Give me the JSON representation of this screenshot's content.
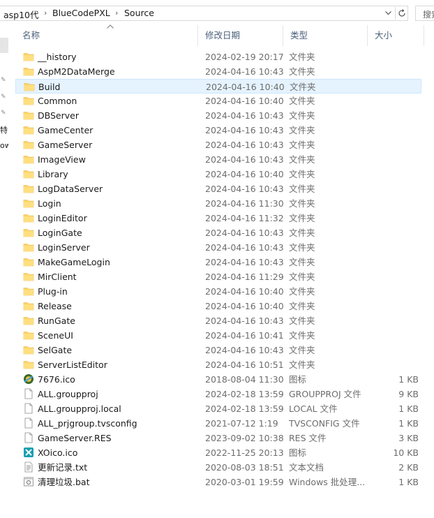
{
  "address": {
    "crumbs": [
      "asp10代",
      "BlueCodePXL",
      "Source"
    ],
    "search_placeholder": "搜索"
  },
  "nav": {
    "partial_labels": [
      "特",
      "ow"
    ]
  },
  "columns": {
    "name": "名称",
    "date": "修改日期",
    "type": "类型",
    "size": "大小"
  },
  "files": [
    {
      "name": "__history",
      "date": "2024-02-19 20:17",
      "type": "文件夹",
      "size": "",
      "icon": "folder-icon"
    },
    {
      "name": "AspM2DataMerge",
      "date": "2024-04-16 10:43",
      "type": "文件夹",
      "size": "",
      "icon": "folder-icon"
    },
    {
      "name": "Build",
      "date": "2024-04-16 10:40",
      "type": "文件夹",
      "size": "",
      "icon": "folder-icon",
      "selected": true
    },
    {
      "name": "Common",
      "date": "2024-04-16 10:40",
      "type": "文件夹",
      "size": "",
      "icon": "folder-icon"
    },
    {
      "name": "DBServer",
      "date": "2024-04-16 10:43",
      "type": "文件夹",
      "size": "",
      "icon": "folder-icon"
    },
    {
      "name": "GameCenter",
      "date": "2024-04-16 10:43",
      "type": "文件夹",
      "size": "",
      "icon": "folder-icon"
    },
    {
      "name": "GameServer",
      "date": "2024-04-16 10:43",
      "type": "文件夹",
      "size": "",
      "icon": "folder-icon"
    },
    {
      "name": "ImageView",
      "date": "2024-04-16 10:43",
      "type": "文件夹",
      "size": "",
      "icon": "folder-icon"
    },
    {
      "name": "Library",
      "date": "2024-04-16 10:40",
      "type": "文件夹",
      "size": "",
      "icon": "folder-icon"
    },
    {
      "name": "LogDataServer",
      "date": "2024-04-16 10:43",
      "type": "文件夹",
      "size": "",
      "icon": "folder-icon"
    },
    {
      "name": "Login",
      "date": "2024-04-16 11:30",
      "type": "文件夹",
      "size": "",
      "icon": "folder-icon"
    },
    {
      "name": "LoginEditor",
      "date": "2024-04-16 11:32",
      "type": "文件夹",
      "size": "",
      "icon": "folder-icon"
    },
    {
      "name": "LoginGate",
      "date": "2024-04-16 10:43",
      "type": "文件夹",
      "size": "",
      "icon": "folder-icon"
    },
    {
      "name": "LoginServer",
      "date": "2024-04-16 10:43",
      "type": "文件夹",
      "size": "",
      "icon": "folder-icon"
    },
    {
      "name": "MakeGameLogin",
      "date": "2024-04-16 10:43",
      "type": "文件夹",
      "size": "",
      "icon": "folder-icon"
    },
    {
      "name": "MirClient",
      "date": "2024-04-16 11:29",
      "type": "文件夹",
      "size": "",
      "icon": "folder-icon"
    },
    {
      "name": "Plug-in",
      "date": "2024-04-16 10:40",
      "type": "文件夹",
      "size": "",
      "icon": "folder-icon"
    },
    {
      "name": "Release",
      "date": "2024-04-16 10:40",
      "type": "文件夹",
      "size": "",
      "icon": "folder-icon"
    },
    {
      "name": "RunGate",
      "date": "2024-04-16 10:43",
      "type": "文件夹",
      "size": "",
      "icon": "folder-icon"
    },
    {
      "name": "SceneUI",
      "date": "2024-04-16 10:41",
      "type": "文件夹",
      "size": "",
      "icon": "folder-icon"
    },
    {
      "name": "SelGate",
      "date": "2024-04-16 10:43",
      "type": "文件夹",
      "size": "",
      "icon": "folder-icon"
    },
    {
      "name": "ServerListEditor",
      "date": "2024-04-16 10:51",
      "type": "文件夹",
      "size": "",
      "icon": "folder-icon"
    },
    {
      "name": "7676.ico",
      "date": "2018-08-04 11:30",
      "type": "图标",
      "size": "1 KB",
      "icon": "ico-image-icon"
    },
    {
      "name": "ALL.groupproj",
      "date": "2024-02-18 13:59",
      "type": "GROUPPROJ 文件",
      "size": "9 KB",
      "icon": "file-icon"
    },
    {
      "name": "ALL.groupproj.local",
      "date": "2024-02-18 13:59",
      "type": "LOCAL 文件",
      "size": "1 KB",
      "icon": "file-icon"
    },
    {
      "name": "ALL_prjgroup.tvsconfig",
      "date": "2021-07-12 1:19",
      "type": "TVSCONFIG 文件",
      "size": "1 KB",
      "icon": "file-icon"
    },
    {
      "name": "GameServer.RES",
      "date": "2023-09-02 10:38",
      "type": "RES 文件",
      "size": "3 KB",
      "icon": "file-icon"
    },
    {
      "name": "XOico.ico",
      "date": "2022-11-25 20:13",
      "type": "图标",
      "size": "10 KB",
      "icon": "xo-ico-icon"
    },
    {
      "name": "更新记录.txt",
      "date": "2020-08-03 18:51",
      "type": "文本文档",
      "size": "2 KB",
      "icon": "text-file-icon"
    },
    {
      "name": "清理垃圾.bat",
      "date": "2020-03-01 19:59",
      "type": "Windows 批处理...",
      "size": "1 KB",
      "icon": "batch-file-icon"
    }
  ],
  "colors": {
    "selected_bg": "#e5f3ff",
    "selected_border": "#cce8ff",
    "folder_yellow": "#ffd466",
    "header_text": "#4c607a"
  }
}
